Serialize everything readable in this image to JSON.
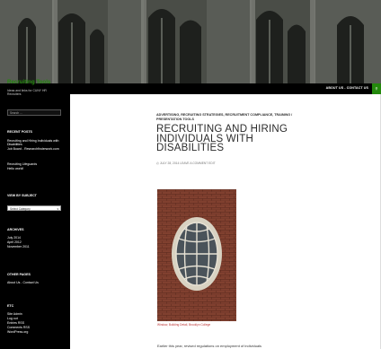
{
  "header": {
    "image_alt": "gothic stone building with arched windows"
  },
  "site": {
    "title": "Recruiting Tools",
    "description": "Ideas and links for CUNY HR Recruiters"
  },
  "nav": {
    "links": "ABOUT US - CONTACT US"
  },
  "sidebar": {
    "search_placeholder": "Search ...",
    "recent_posts_title": "RECENT POSTS",
    "recent_posts": [
      "Recruiting and Hiring Individuals with Disabilities",
      "Job Board - Researchfinderwork.com",
      "Recruiting Lifeguards",
      "Hello world!"
    ],
    "view_by_subject_title": "VIEW BY SUBJECT",
    "select_category": "Select Category",
    "archives_title": "ARCHIVES",
    "archives": [
      "July 2014",
      "April 2012",
      "November 2011"
    ],
    "other_pages_title": "OTHER PAGES",
    "other_pages": [
      "About Us - Contact Us"
    ],
    "etc_title": "ETC",
    "etc": [
      "Site Admin",
      "Log out",
      "Entries RSS",
      "Comments RSS",
      "WordPress.org"
    ]
  },
  "post": {
    "categories": "ADVERTISING, RECRUITING STRATEGIES, RECRUITMENT COMPLIANCE, TRAINING / PRESENTATION TOOLS",
    "title": "RECRUITING AND HIRING INDIVIDUALS WITH DISABILITIES",
    "meta": "JULY 28, 2014   LEAVE A COMMENT   EDIT",
    "caption": "Window, Building Detail, Brooklyn College",
    "excerpt": "Earlier this year, revised regulations on employment of individuals"
  },
  "colors": {
    "accent": "#24890d",
    "sidebar_bg": "#000000",
    "caption": "#bb3333"
  }
}
